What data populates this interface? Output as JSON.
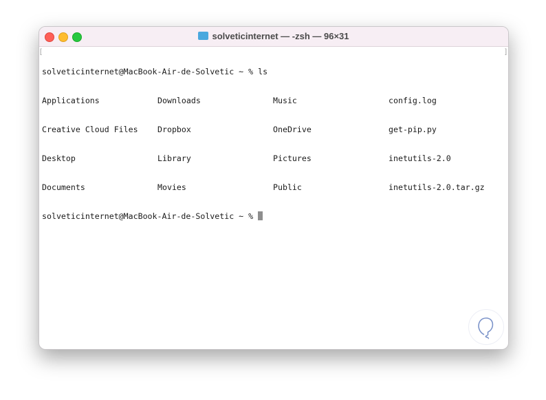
{
  "window": {
    "title": "solveticinternet — -zsh — 96×31",
    "icon": "folder-icon"
  },
  "terminal": {
    "prompt_line": "solveticinternet@MacBook-Air-de-Solvetic ~ % ls",
    "rows": [
      [
        "Applications",
        "Downloads",
        "Music",
        "config.log"
      ],
      [
        "Creative Cloud Files",
        "Dropbox",
        "OneDrive",
        "get-pip.py"
      ],
      [
        "Desktop",
        "Library",
        "Pictures",
        "inetutils-2.0"
      ],
      [
        "Documents",
        "Movies",
        "Public",
        "inetutils-2.0.tar.gz"
      ]
    ],
    "current_prompt": "solveticinternet@MacBook-Air-de-Solvetic ~ % "
  },
  "colors": {
    "titlebar": "#f7eef4",
    "cursor": "#8e8e8e"
  }
}
